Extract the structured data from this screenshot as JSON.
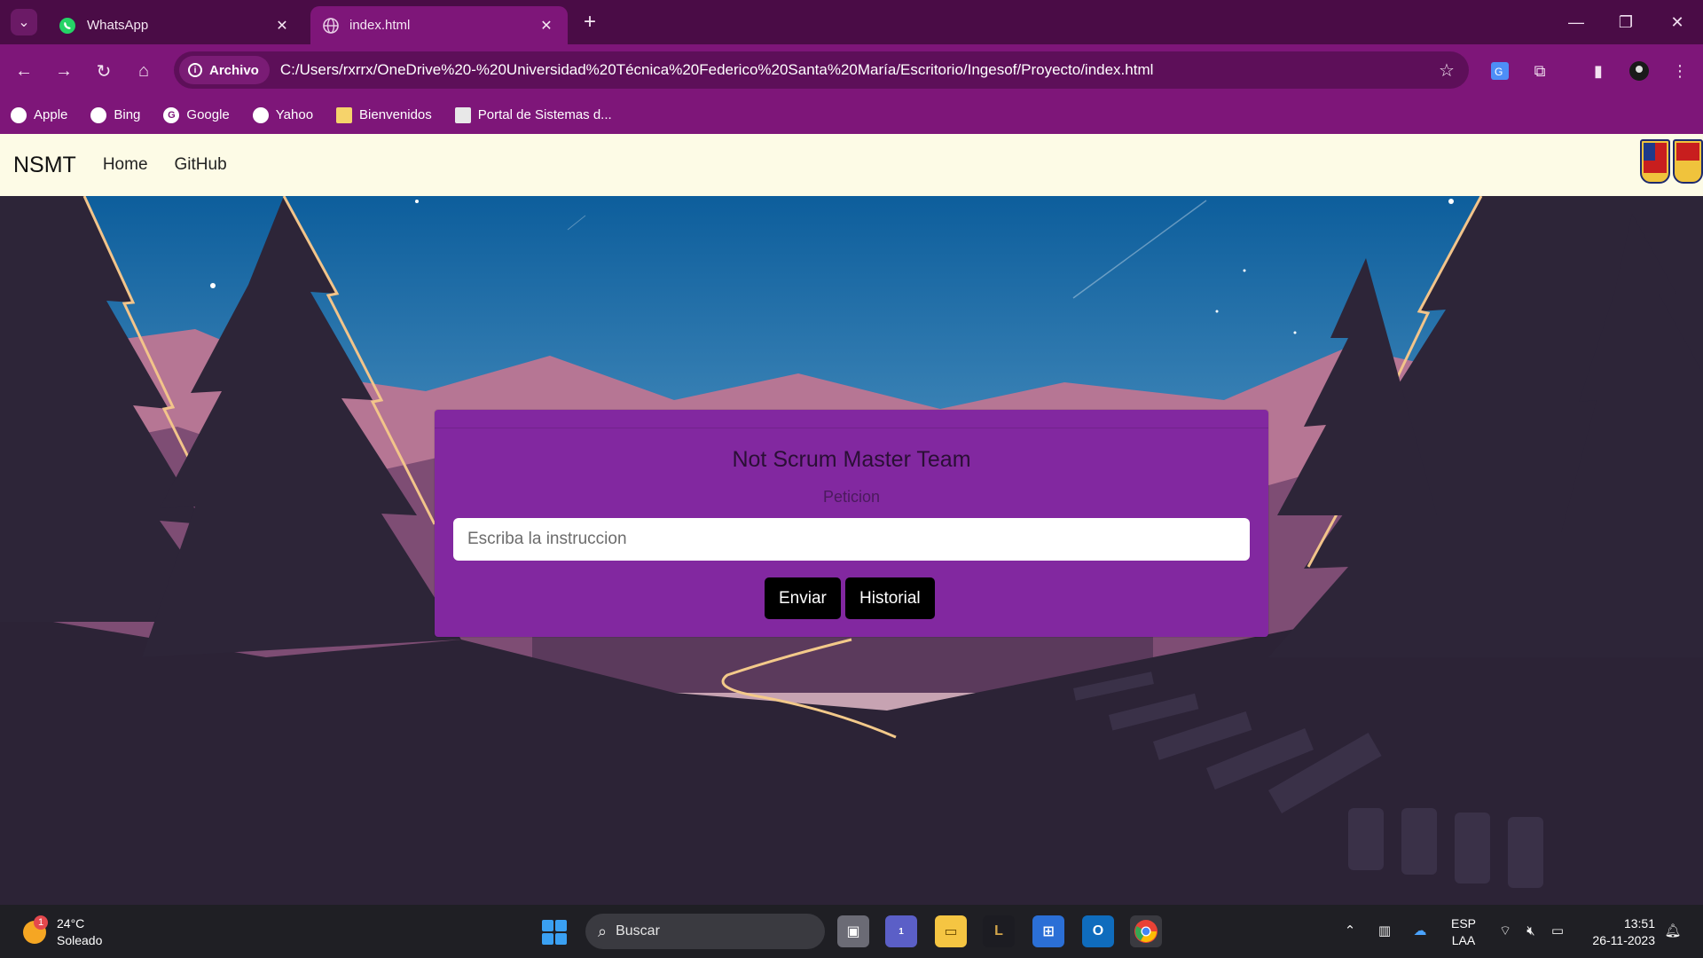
{
  "browser": {
    "tabs": [
      {
        "title": "WhatsApp",
        "icon": "whatsapp-icon",
        "active": false
      },
      {
        "title": "index.html",
        "icon": "globe-icon",
        "active": true
      }
    ],
    "address": {
      "security_label": "Archivo",
      "url": "C:/Users/rxrrx/OneDrive%20-%20Universidad%20Técnica%20Federico%20Santa%20María/Escritorio/Ingesof/Proyecto/index.html"
    },
    "bookmarks": [
      {
        "label": "Apple",
        "icon": "apple-icon"
      },
      {
        "label": "Bing",
        "icon": "globe-icon"
      },
      {
        "label": "Google",
        "icon": "google-icon"
      },
      {
        "label": "Yahoo",
        "icon": "globe-icon"
      },
      {
        "label": "Bienvenidos",
        "icon": "folder-icon"
      },
      {
        "label": "Portal de Sistemas d...",
        "icon": "page-icon"
      }
    ]
  },
  "site": {
    "brand": "NSMT",
    "nav": [
      "Home",
      "GitHub"
    ],
    "card": {
      "title": "Not Scrum Master Team",
      "subtitle": "Peticion",
      "input_placeholder": "Escriba la instruccion",
      "input_value": "",
      "send_label": "Enviar",
      "history_label": "Historial"
    }
  },
  "taskbar": {
    "weather": {
      "temp": "24°C",
      "condition": "Soleado",
      "badge": "1"
    },
    "search_label": "Buscar",
    "language": {
      "line1": "ESP",
      "line2": "LAA"
    },
    "clock": {
      "time": "13:51",
      "date": "26-11-2023"
    },
    "teams_badge": "1"
  },
  "colors": {
    "tabbar": "#4a0c46",
    "toolbar": "#7e1679",
    "navbar": "#fdfbe6",
    "card": "#8228a0",
    "button": "#000000"
  }
}
